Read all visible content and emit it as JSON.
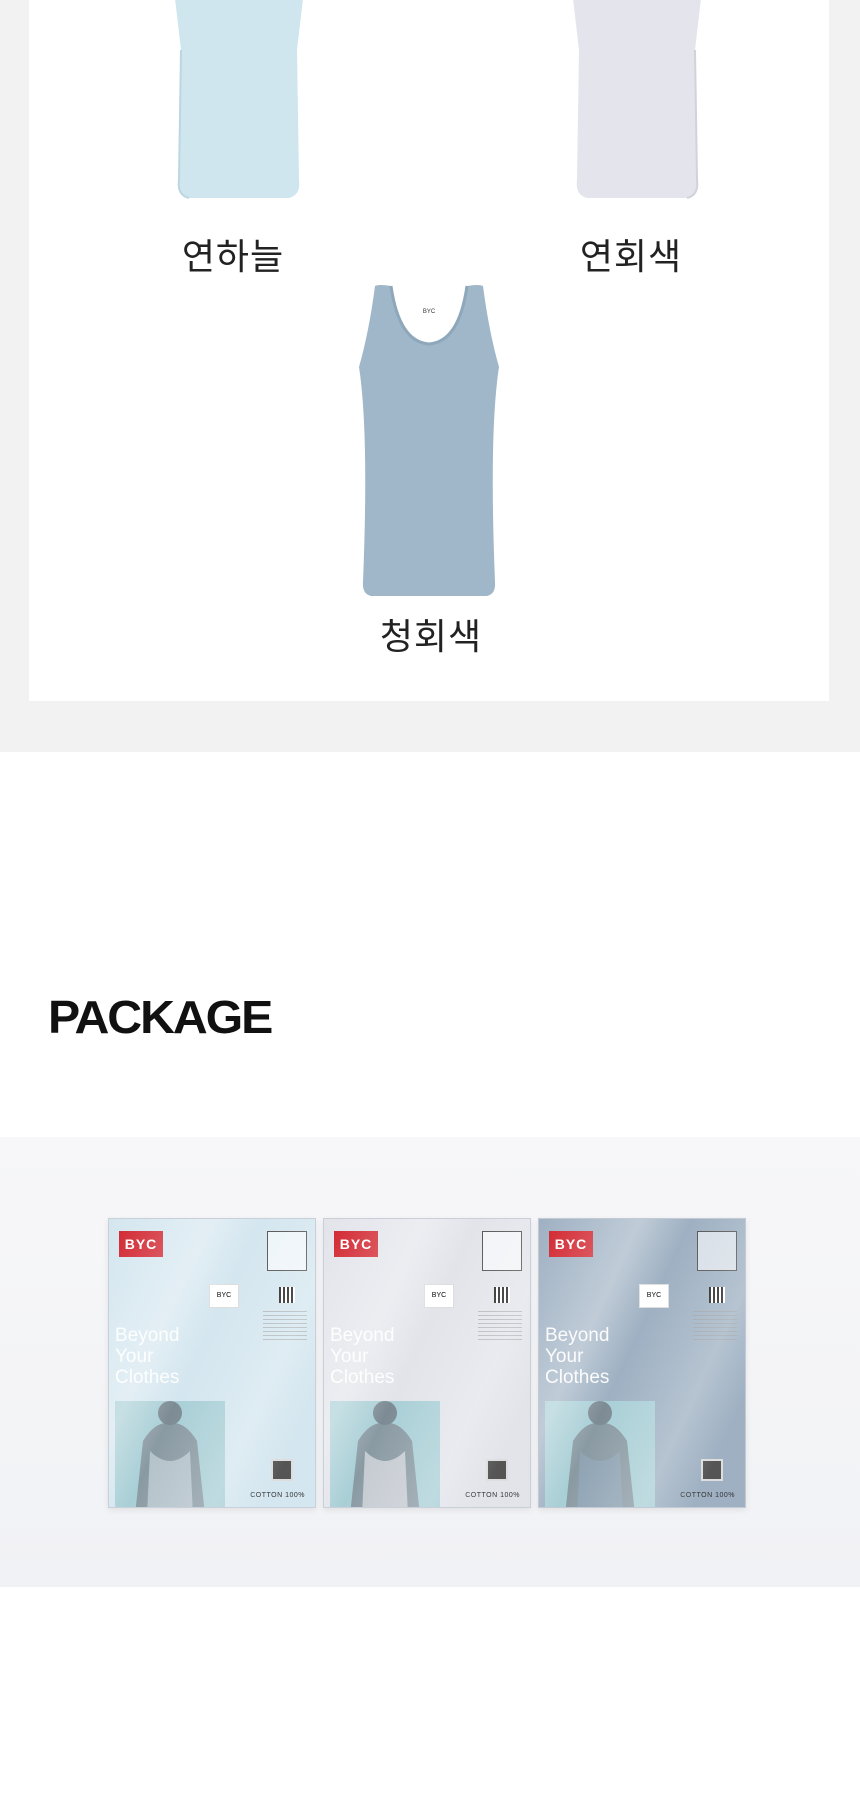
{
  "colors": {
    "items": [
      {
        "label": "연하늘",
        "color": "#cfe6ef"
      },
      {
        "label": "연회색",
        "color": "#e3e4ec"
      },
      {
        "label": "청회색",
        "color": "#9fb7c9"
      }
    ]
  },
  "package": {
    "title": "PACKAGE",
    "packs": [
      {
        "brand": "BYC",
        "slogan": "Beyond\nYour\nClothes",
        "cotton": "COTTON 100%",
        "tag": "BYC",
        "color": "#d4e6ef"
      },
      {
        "brand": "BYC",
        "slogan": "Beyond\nYour\nClothes",
        "cotton": "COTTON 100%",
        "tag": "BYC",
        "color": "#e2e4ea"
      },
      {
        "brand": "BYC",
        "slogan": "Beyond\nYour\nClothes",
        "cotton": "COTTON 100%",
        "tag": "BYC",
        "color": "#9eb0c2"
      }
    ]
  }
}
